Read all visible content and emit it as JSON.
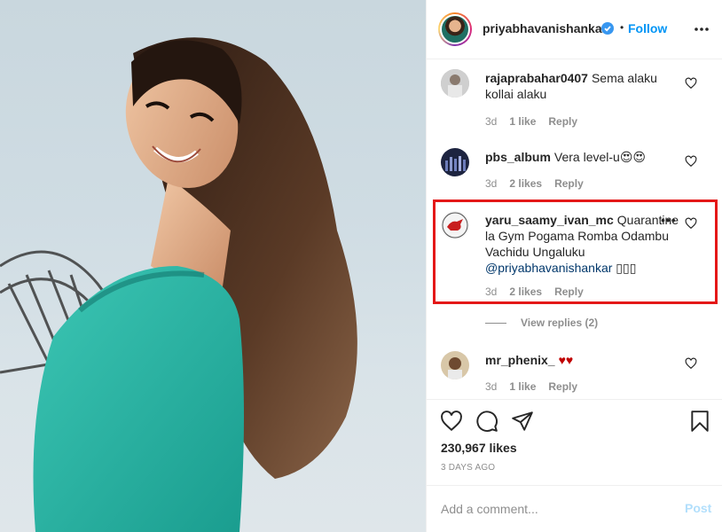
{
  "header": {
    "username": "priyabhavanishankar",
    "separator": "•",
    "follow_label": "Follow",
    "verified_icon": "verified-badge-icon",
    "more_icon": "more-options-icon"
  },
  "comments": [
    {
      "username": "rajaprabahar0407",
      "text": "Sema alaku kollai alaku",
      "time": "3d",
      "likes": "1 like",
      "reply": "Reply"
    },
    {
      "username": "pbs_album",
      "text": "Vera level-u😍😍",
      "time": "3d",
      "likes": "2 likes",
      "reply": "Reply"
    },
    {
      "username": "yaru_saamy_ivan_mc",
      "text_head": "Quarantine",
      "text": "la Gym Pogama Romba Odambu Vachidu Ungaluku",
      "mention": "@priyabhavanishankar",
      "trailing": "▯▯▯",
      "time": "3d",
      "likes": "2 likes",
      "reply": "Reply",
      "more": "•••"
    },
    {
      "username": "mr_phenix_",
      "text": "♥♥",
      "time": "3d",
      "likes": "1 like",
      "reply": "Reply"
    }
  ],
  "view_replies": "View replies (2)",
  "actions": {
    "like_icon": "heart-icon",
    "comment_icon": "comment-icon",
    "share_icon": "share-icon",
    "save_icon": "bookmark-icon"
  },
  "likes_count": "230,967 likes",
  "posted_ago": "3 DAYS AGO",
  "add_comment": {
    "placeholder": "Add a comment...",
    "post_label": "Post"
  },
  "colors": {
    "link_blue": "#0095f6",
    "highlight_red": "#e41818",
    "post_disabled": "#b2dffc",
    "hearts": "#c00000"
  }
}
